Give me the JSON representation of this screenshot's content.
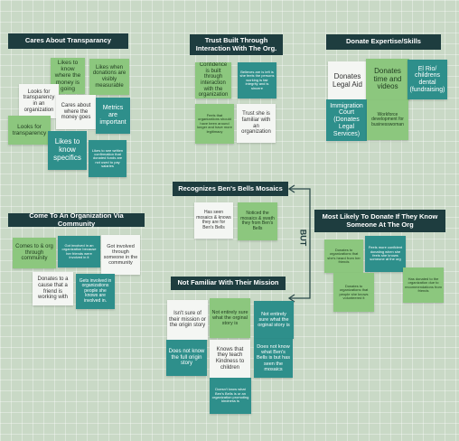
{
  "sections": {
    "transparency": {
      "title": "Cares About Transparancy",
      "notes": [
        "Likes to know where the money is going",
        "Likes when donations are visibly measurable",
        "Looks for transparency in an organization",
        "Cares about where the money goes",
        "Metrics are important",
        "Looks for transparency",
        "Likes to know specifics",
        "Likes to see written confirmation that donated funds are not used to pay salaries"
      ]
    },
    "trust": {
      "title": "Trust Built Through Interaction With The Org.",
      "notes": [
        "Confidence is built through interaction with the organization",
        "Believes are is left is she feels the persons working is fair integrity and is sincere",
        "Feels that organizations should have been around longer and have more legitimacy",
        "Trust she is familiar with an organization"
      ]
    },
    "expertise": {
      "title": "Donate Expertise/Skills",
      "notes": [
        "Donates Legal Aid",
        "Donates time and videos",
        "El Rio/ childrens dental (fundraising)",
        "Immigration Court (Donates Legal Services)",
        "Workforce development for businesswoman"
      ]
    },
    "mosaics": {
      "title": "Recognizes Ben's Bells Mosaics",
      "notes": [
        "Has seen mosaics & knows they are for Ben's Bells",
        "Noticed the mosaics & swath they from Ben's Bells"
      ]
    },
    "community": {
      "title": "Come To An Organization Via Community",
      "notes": [
        "Comes to & org through community",
        "Got involved in an organization because her friends were involved in it",
        "Got involved through someone in the community",
        "Donates to a cause that a friend is working with",
        "Gets involved in organizations people she knows are involved in."
      ]
    },
    "likely": {
      "title": "Most Likely To Donate If They Know Someone At The Org",
      "notes": [
        "Donates to organizations that she's heard from her friends",
        "Feels more confident donating when she feels she knows someone at the org",
        "Donates to organizations that people she knows volunteered it",
        "Has donated to the organization due to recommendations from friends"
      ]
    },
    "mission": {
      "title": "Not Familiar With Their Mission",
      "notes": [
        "Isn't sure of their mission or the origin story",
        "Not entirely sure what the orginal story is",
        "Not entirely sure what the orginal story is",
        "Does not know the full origin story",
        "Knows that they teach Kindness to children",
        "Does not know what Ben's Bells is but has seen the mosaics",
        "Doesn't know what Ben's Bells is or an organization promoting kindness is"
      ]
    }
  },
  "connector_label": "BUT"
}
